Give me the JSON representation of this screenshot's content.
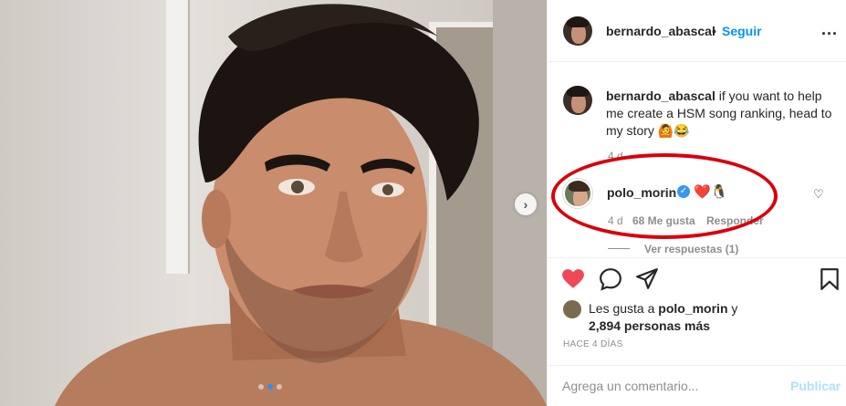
{
  "post": {
    "image_alt": "Selfie of a man with dark wavy hair",
    "carousel_dots": 3,
    "active_dot": 1
  },
  "header": {
    "username": "bernardo_abascal",
    "separator": "•",
    "follow_label": "Seguir",
    "more_label": "..."
  },
  "caption": {
    "username": "bernardo_abascal",
    "text": " if you want to help me create a HSM song ranking, head to my story 🙆😂",
    "time": "4 d"
  },
  "comment": {
    "username": "polo_morin",
    "verified": "✓",
    "text": "❤️🐧",
    "heart": "♡",
    "time": "4 d",
    "likes": "68 Me gusta",
    "reply": "Responder",
    "view_replies": "Ver respuestas (1)"
  },
  "likes": {
    "prefix": "Les gusta a ",
    "user": "polo_morin",
    "suffix": " y",
    "count": "2,894 personas más"
  },
  "date": "HACE 4 DÍAS",
  "comment_box": {
    "placeholder": "Agrega un comentario...",
    "publish_label": "Publicar"
  },
  "colors": {
    "accent": "#0095f6",
    "like": "#ed4956",
    "highlight_ring": "#d9000d"
  }
}
